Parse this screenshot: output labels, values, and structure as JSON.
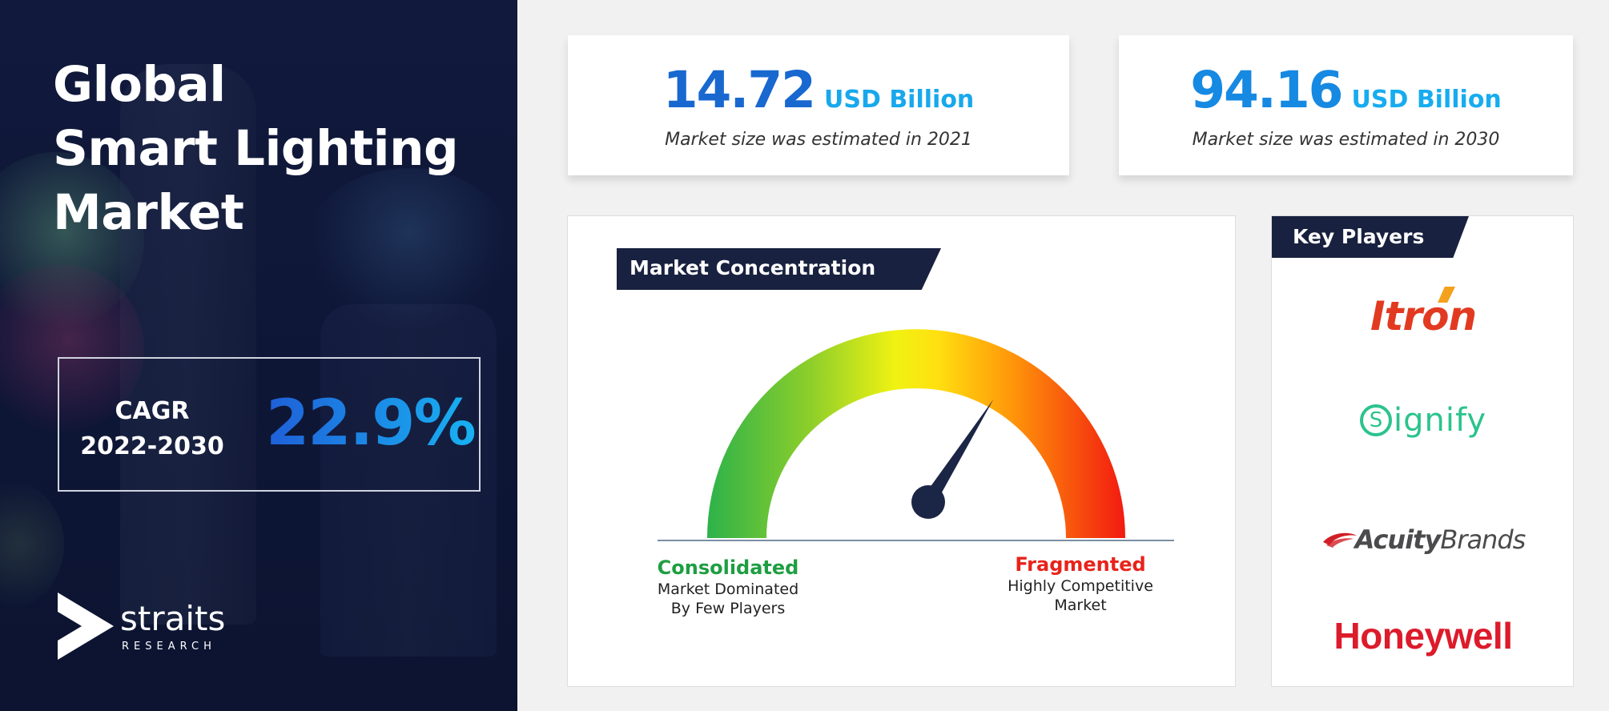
{
  "hero": {
    "title_line1": "Global",
    "title_line2": "Smart Lighting",
    "title_line3": "Market",
    "cagr_label_line1": "CAGR",
    "cagr_label_line2": "2022-2030",
    "cagr_value": "22.9%"
  },
  "brand": {
    "name": "straits",
    "sub": "RESEARCH"
  },
  "stats": [
    {
      "value": "14.72",
      "unit": "USD Billion",
      "description": "Market size was estimated  in 2021"
    },
    {
      "value": "94.16",
      "unit": "USD Billion",
      "description": "Market size was estimated  in 2030"
    }
  ],
  "market_concentration": {
    "title": "Market Concentration",
    "gauge_level": 0.68,
    "left_label": {
      "title": "Consolidated",
      "line1": "Market Dominated",
      "line2": "By Few Players"
    },
    "right_label": {
      "title": "Fragmented",
      "line1": "Highly Competitive",
      "line2": "Market"
    }
  },
  "key_players": {
    "title": "Key Players",
    "companies": [
      {
        "name": "Itron"
      },
      {
        "name": "ignify",
        "ring_letter": "S"
      },
      {
        "name_light": "Acuity",
        "name_bold": "Brands"
      },
      {
        "name": "Honeywell"
      }
    ]
  },
  "colors": {
    "navy": "#18213f",
    "accent_blue": "#1868d0",
    "accent_cyan": "#18a8ec",
    "consolidated_green": "#1e9e41",
    "fragmented_red": "#e8231b"
  }
}
